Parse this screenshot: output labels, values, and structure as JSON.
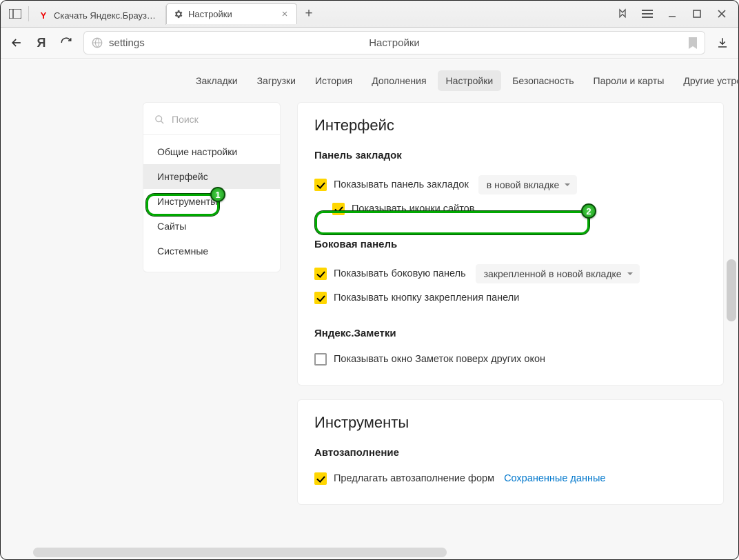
{
  "window": {
    "tabs": [
      {
        "title": "Скачать Яндекс.Браузер д",
        "favicon": "Y"
      },
      {
        "title": "Настройки",
        "favicon": "gear"
      }
    ],
    "newtab": "+"
  },
  "toolbar": {
    "yandex_letter": "Я",
    "omnibox_text": "settings",
    "omnibox_center": "Настройки"
  },
  "topnav": {
    "items": [
      "Закладки",
      "Загрузки",
      "История",
      "Дополнения",
      "Настройки",
      "Безопасность",
      "Пароли и карты",
      "Другие устро"
    ],
    "active_index": 4
  },
  "sidebar": {
    "search_placeholder": "Поиск",
    "items": [
      "Общие настройки",
      "Интерфейс",
      "Инструменты",
      "Сайты",
      "Системные"
    ],
    "active_index": 1
  },
  "sections": {
    "interface": {
      "heading": "Интерфейс",
      "bookmarks_panel": {
        "title": "Панель закладок",
        "show_panel": "Показывать панель закладок",
        "show_panel_mode": "в новой вкладке",
        "show_icons": "Показывать иконки сайтов"
      },
      "side_panel": {
        "title": "Боковая панель",
        "show_side": "Показывать боковую панель",
        "show_side_mode": "закрепленной в новой вкладке",
        "show_pin_btn": "Показывать кнопку закрепления панели"
      },
      "notes": {
        "title": "Яндекс.Заметки",
        "show_notes": "Показывать окно Заметок поверх других окон"
      }
    },
    "tools": {
      "heading": "Инструменты",
      "autofill": {
        "title": "Автозаполнение",
        "suggest": "Предлагать автозаполнение форм",
        "saved_link": "Сохраненные данные"
      }
    }
  },
  "badges": {
    "one": "1",
    "two": "2"
  }
}
